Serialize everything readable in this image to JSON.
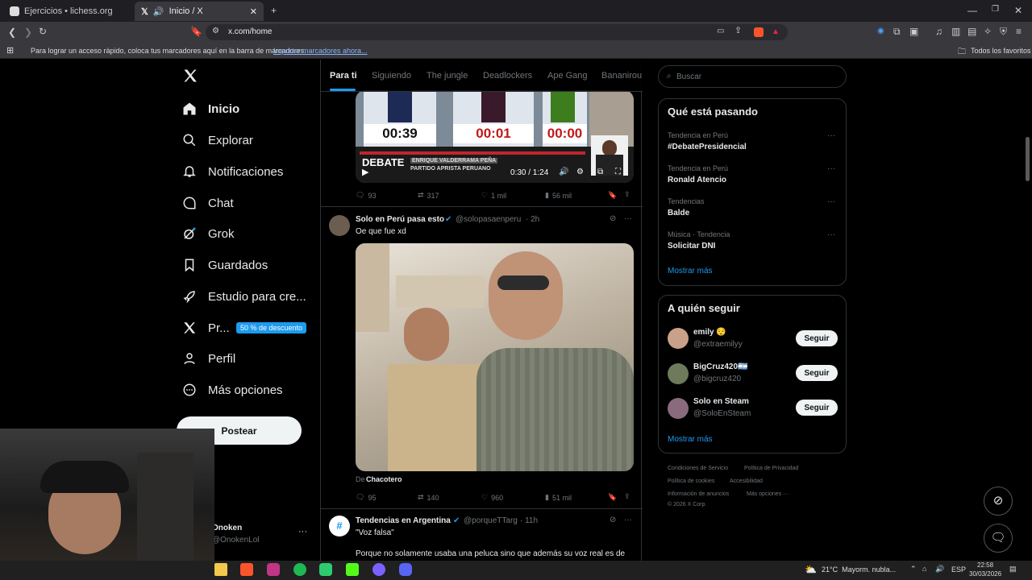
{
  "browser": {
    "tabs": [
      {
        "label": "Ejercicios • lichess.org"
      },
      {
        "label": "Inicio / X"
      }
    ],
    "url": "x.com/home",
    "bookmarks_hint": "Para lograr un acceso rápido, coloca tus marcadores aquí en la barra de marcadores.",
    "import_link": "Importar marcadores ahora...",
    "all_favorites": "Todos los favoritos"
  },
  "sidebar": {
    "items": [
      {
        "label": "Inicio",
        "icon": "home-icon"
      },
      {
        "label": "Explorar",
        "icon": "search-icon"
      },
      {
        "label": "Notificaciones",
        "icon": "bell-icon"
      },
      {
        "label": "Chat",
        "icon": "chat-icon"
      },
      {
        "label": "Grok",
        "icon": "grok-icon"
      },
      {
        "label": "Guardados",
        "icon": "bookmark-icon"
      },
      {
        "label": "Estudio para cre...",
        "icon": "rocket-icon"
      },
      {
        "label": "Pr...",
        "icon": "x-logo-icon"
      },
      {
        "label": "Perfil",
        "icon": "person-icon"
      },
      {
        "label": "Más opciones",
        "icon": "more-circle-icon"
      }
    ],
    "premium_badge": "50 % de descuento",
    "post_button": "Postear",
    "account_name": "Onoken",
    "account_handle": "@OnokenLol"
  },
  "feed": {
    "tabs": [
      "Para ti",
      "Siguiendo",
      "The jungle",
      "Deadlockers",
      "Ape Gang",
      "Bananirou"
    ],
    "post1": {
      "video_timers": [
        "00:39",
        "00:01",
        "00:00"
      ],
      "lower_third_title": "DEBATE",
      "lower_third_name": "ENRIQUE VALDERRAMA PEÑA",
      "lower_third_party": "PARTIDO APRISTA PERUANO",
      "video_time": "0:30 / 1:24",
      "replies": "93",
      "reposts": "317",
      "likes": "1 mil",
      "views": "56 mil"
    },
    "post2": {
      "author": "Solo en Perú pasa esto",
      "handle": "@solopasaenperu",
      "time": "· 2h",
      "text": "Oe que fue xd",
      "credit_prefix": "De",
      "credit_name": "Chacotero",
      "replies": "95",
      "reposts": "140",
      "likes": "960",
      "views": "51 mil"
    },
    "post3": {
      "author": "Tendencias en Argentina",
      "handle": "@porqueTTarg",
      "time": "· 11h",
      "text1": "\"Voz falsa\"",
      "text2": "Porque no solamente usaba una peluca sino que además su voz real es de"
    }
  },
  "right": {
    "search_placeholder": "Buscar",
    "trends_title": "Qué está pasando",
    "trends": [
      {
        "context": "Tendencia en Perú",
        "title": "#DebatePresidencial"
      },
      {
        "context": "Tendencia en Perú",
        "title": "Ronald Atencio"
      },
      {
        "context": "Tendencias",
        "title": "Balde"
      },
      {
        "context": "Música · Tendencia",
        "title": "Solicitar DNI"
      }
    ],
    "show_more": "Mostrar más",
    "follow_title": "A quién seguir",
    "follow": [
      {
        "name": "emily 😌",
        "handle": "@extraemilyy"
      },
      {
        "name": "BigCruz420🇦🇷",
        "handle": "@bigcruz420"
      },
      {
        "name": "Solo en Steam",
        "handle": "@SoloEnSteam"
      }
    ],
    "follow_button": "Seguir",
    "footer": {
      "l1a": "Condiciones de Servicio",
      "l1b": "Política de Privacidad",
      "l2a": "Política de cookies",
      "l2b": "Accesibilidad",
      "l3a": "Información de anuncios",
      "l3b": "Más opciones ···",
      "copyright": "© 2026 X Corp."
    }
  },
  "taskbar": {
    "weather": "21°C  Mayorm. nubla...",
    "lang": "ESP",
    "time": "22:58",
    "date": "30/03/2026"
  }
}
